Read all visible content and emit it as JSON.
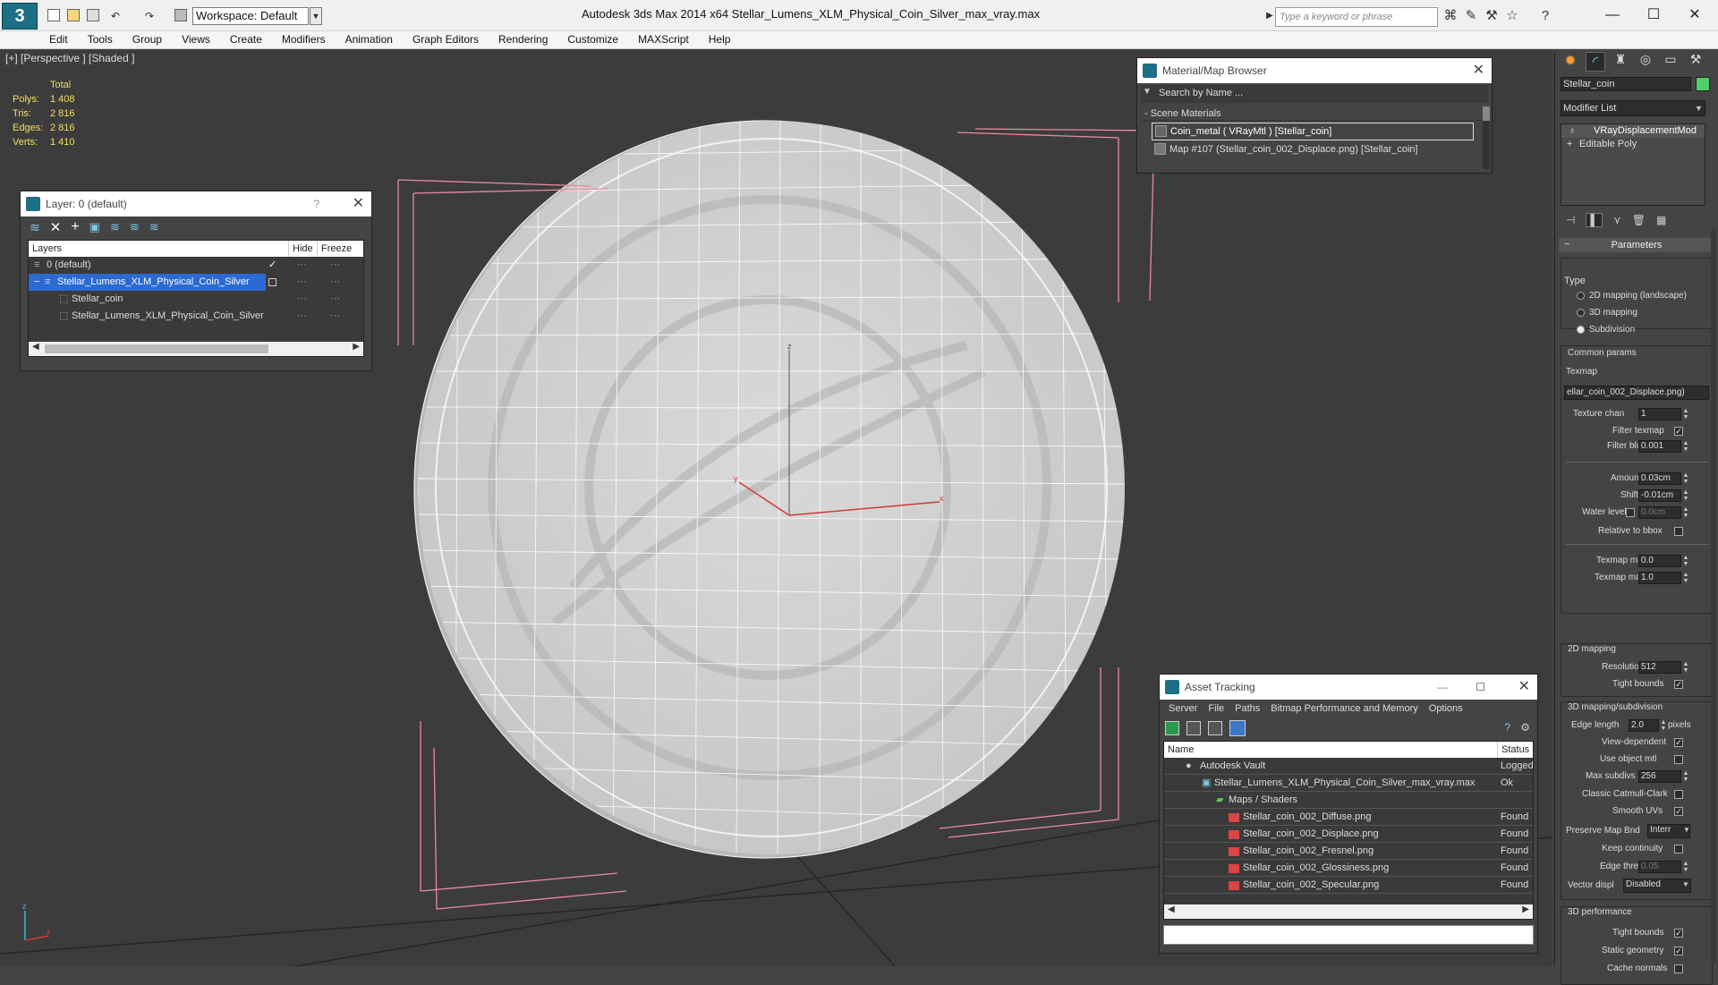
{
  "app": {
    "title": "Autodesk 3ds Max  2014 x64     Stellar_Lumens_XLM_Physical_Coin_Silver_max_vray.max",
    "workspace": "Workspace: Default",
    "search_placeholder": "Type a keyword or phrase",
    "logo": "3"
  },
  "menu": [
    "Edit",
    "Tools",
    "Group",
    "Views",
    "Create",
    "Modifiers",
    "Animation",
    "Graph Editors",
    "Rendering",
    "Customize",
    "MAXScript",
    "Help"
  ],
  "viewport": {
    "label": "[+] [Perspective ] [Shaded ]",
    "stats": {
      "header": "Total",
      "polys_label": "Polys:",
      "polys": "1 408",
      "tris_label": "Tris:",
      "tris": "2 816",
      "edges_label": "Edges:",
      "edges": "2 816",
      "verts_label": "Verts:",
      "verts": "1 410"
    },
    "axis": {
      "x": "x",
      "y": "y",
      "z": "z"
    }
  },
  "layers_panel": {
    "title": "Layer: 0 (default)",
    "help": "?",
    "columns": {
      "layers": "Layers",
      "hide": "Hide",
      "freeze": "Freeze"
    },
    "rows": [
      {
        "label": "0 (default)",
        "check": "✓"
      },
      {
        "label": "Stellar_Lumens_XLM_Physical_Coin_Silver"
      },
      {
        "label": "Stellar_coin"
      },
      {
        "label": "Stellar_Lumens_XLM_Physical_Coin_Silver"
      }
    ]
  },
  "material_browser": {
    "title": "Material/Map Browser",
    "search_placeholder": "Search by Name ...",
    "section": "- Scene Materials",
    "items": [
      "Coin_metal  ( VRayMtl ) [Stellar_coin]",
      "Map #107 (Stellar_coin_002_Displace.png) [Stellar_coin]"
    ]
  },
  "asset_tracking": {
    "title": "Asset Tracking",
    "menu": [
      "Server",
      "File",
      "Paths",
      "Bitmap Performance and Memory",
      "Options"
    ],
    "columns": {
      "name": "Name",
      "status": "Status"
    },
    "rows": [
      {
        "name": "Autodesk Vault",
        "status": "Logged"
      },
      {
        "name": "Stellar_Lumens_XLM_Physical_Coin_Silver_max_vray.max",
        "status": "Ok"
      },
      {
        "name": "Maps / Shaders",
        "status": ""
      },
      {
        "name": "Stellar_coin_002_Diffuse.png",
        "status": "Found"
      },
      {
        "name": "Stellar_coin_002_Displace.png",
        "status": "Found"
      },
      {
        "name": "Stellar_coin_002_Fresnel.png",
        "status": "Found"
      },
      {
        "name": "Stellar_coin_002_Glossiness.png",
        "status": "Found"
      },
      {
        "name": "Stellar_coin_002_Specular.png",
        "status": "Found"
      }
    ]
  },
  "command_panel": {
    "object_name": "Stellar_coin",
    "object_color": "#4fd06a",
    "modifier_list": "Modifier List",
    "stack": [
      "VRayDisplacementMod",
      "Editable Poly"
    ],
    "parameters_title": "Parameters",
    "type_label": "Type",
    "type_options": [
      "2D mapping (landscape)",
      "3D mapping",
      "Subdivision"
    ],
    "common_params": "Common params",
    "texmap_label": "Texmap",
    "texmap_value": "ellar_coin_002_Displace.png)",
    "texture_chan_label": "Texture chan",
    "texture_chan": "1",
    "filter_texmap_label": "Filter texmap",
    "filter_blur_label": "Filter blur",
    "filter_blur": "0.001",
    "amount_label": "Amount",
    "amount": "0.03cm",
    "shift_label": "Shift",
    "shift": "-0.01cm",
    "water_level_label": "Water level",
    "water_level": "0.0cm",
    "relative_bbox_label": "Relative to bbox",
    "texmap_min_label": "Texmap min",
    "texmap_min": "0.0",
    "texmap_max_label": "Texmap max",
    "texmap_max": "1.0",
    "mapping2d_title": "2D mapping",
    "resolution_label": "Resolution",
    "resolution": "512",
    "tight_bounds_label": "Tight bounds",
    "mapping3d_title": "3D mapping/subdivision",
    "edge_length_label": "Edge length",
    "edge_length": "2.0",
    "pixels_label": "pixels",
    "view_dependent_label": "View-dependent",
    "use_object_mtl_label": "Use object mtl",
    "max_subdivs_label": "Max subdivs",
    "max_subdivs": "256",
    "classic_catmull_label": "Classic Catmull-Clark",
    "smooth_uvs_label": "Smooth UVs",
    "preserve_map_label": "Preserve Map Bnd",
    "preserve_map": "Interr",
    "keep_continuity_label": "Keep continuity",
    "edge_thresh_label": "Edge thresh",
    "edge_thresh": "0.05",
    "vector_displ_label": "Vector displ",
    "vector_displ": "Disabled",
    "perf_title": "3D performance",
    "tight_bounds2_label": "Tight bounds",
    "static_geometry_label": "Static geometry",
    "cache_normals_label": "Cache normals",
    "check": "✓"
  }
}
